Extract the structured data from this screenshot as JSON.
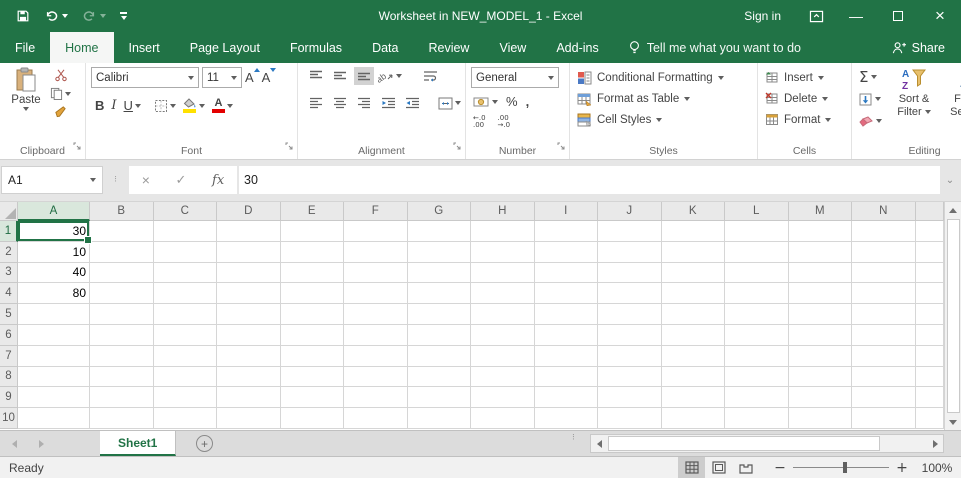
{
  "title_bar": {
    "title": "Worksheet in NEW_MODEL_1 - Excel",
    "sign_in_label": "Sign in"
  },
  "ribbon_tabs": {
    "file": "File",
    "tabs": [
      "Home",
      "Insert",
      "Page Layout",
      "Formulas",
      "Data",
      "Review",
      "View",
      "Add-ins"
    ],
    "active_tab": "Home",
    "tell_me": "Tell me what you want to do",
    "share_label": "Share"
  },
  "ribbon": {
    "clipboard": {
      "label": "Clipboard",
      "paste_label": "Paste"
    },
    "font": {
      "label": "Font",
      "family": "Calibri",
      "size": "11",
      "bold": "B",
      "italic": "I",
      "underline": "U"
    },
    "alignment": {
      "label": "Alignment"
    },
    "number": {
      "label": "Number",
      "format": "General",
      "percent": "%",
      "comma": ",",
      "inc_decimal": "←.0\n.00",
      "dec_decimal": ".00\n→.0"
    },
    "styles": {
      "label": "Styles",
      "conditional_formatting": "Conditional Formatting",
      "format_as_table": "Format as Table",
      "cell_styles": "Cell Styles"
    },
    "cells": {
      "label": "Cells",
      "insert": "Insert",
      "delete": "Delete",
      "format": "Format"
    },
    "editing": {
      "label": "Editing",
      "autosum": "Σ",
      "sort_filter": "Sort & Filter",
      "find_select": "Find & Select"
    }
  },
  "formula_bar": {
    "name_box": "A1",
    "fx_label": "fx",
    "value": "30"
  },
  "grid": {
    "selected_cell": "A1",
    "columns": [
      "A",
      "B",
      "C",
      "D",
      "E",
      "F",
      "G",
      "H",
      "I",
      "J",
      "K",
      "L",
      "M",
      "N"
    ],
    "row_count": 10,
    "cells": {
      "A1": "30",
      "A2": "10",
      "A3": "40",
      "A4": "80"
    }
  },
  "sheet_tab_bar": {
    "tabs": [
      {
        "name": "Sheet1",
        "active": true
      }
    ]
  },
  "status_bar": {
    "status": "Ready",
    "zoom_level": "100%"
  }
}
